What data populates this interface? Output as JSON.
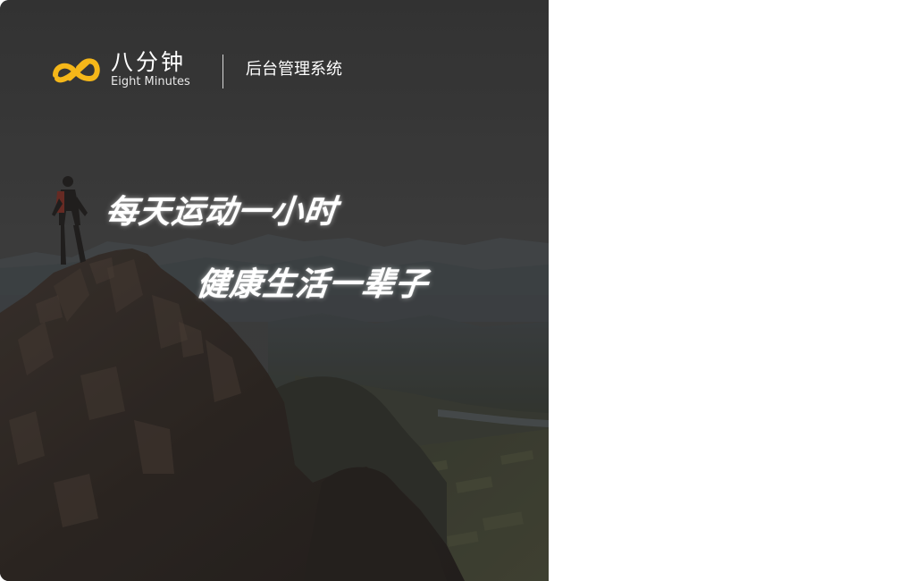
{
  "brand": {
    "name": "八分钟",
    "name_en": "Eight Minutes",
    "logo_icon": "infinity-logo-icon",
    "accent_color": "#F5B719"
  },
  "system_title": "后台管理系统",
  "hero": {
    "slogan_line1": "每天运动一小时",
    "slogan_line2": "健康生活一辈子"
  }
}
